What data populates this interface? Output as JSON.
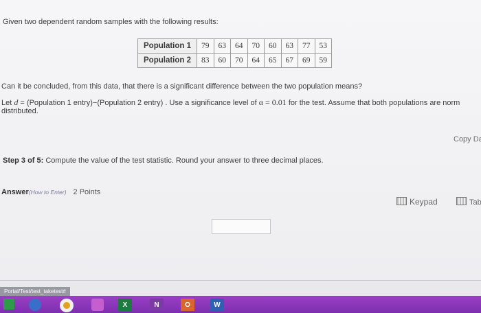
{
  "question": {
    "intro": "Given two dependent random samples with the following results:",
    "table": {
      "rows": [
        {
          "label": "Population 1",
          "values": [
            "79",
            "63",
            "64",
            "70",
            "60",
            "63",
            "77",
            "53"
          ]
        },
        {
          "label": "Population 2",
          "values": [
            "83",
            "60",
            "70",
            "64",
            "65",
            "67",
            "69",
            "59"
          ]
        }
      ]
    },
    "prompt": "Can it be concluded, from this data, that there is a significant difference between the two population means?",
    "let_prefix": "Let ",
    "let_var": "d",
    "let_eq": " = ",
    "let_def": "(Population 1 entry)−(Population 2 entry) . Use a significance level of ",
    "alpha_expr": "α = 0.01",
    "let_suffix": " for the test. Assume that both populations are norm",
    "distributed": "distributed."
  },
  "toolbar": {
    "copy_label": "Copy Da"
  },
  "step": {
    "label": "Step 3 of 5:",
    "text": " Compute the value of the test statistic. Round your answer to three decimal places."
  },
  "answer": {
    "label": "Answer",
    "how_to": "(How to Enter)",
    "points": "2 Points",
    "keypad_label": "Keypad",
    "table_label": "Table",
    "value": ""
  },
  "status": {
    "url_fragment": "Portal/Test/test_taketest#"
  },
  "taskbar": {
    "apps": [
      "app-1",
      "app-2",
      "chrome",
      "app-4",
      "X",
      "N",
      "O",
      "W"
    ]
  },
  "colors": {
    "taskbar": "#8a35b8",
    "page_bg": "#f2f2f4"
  }
}
